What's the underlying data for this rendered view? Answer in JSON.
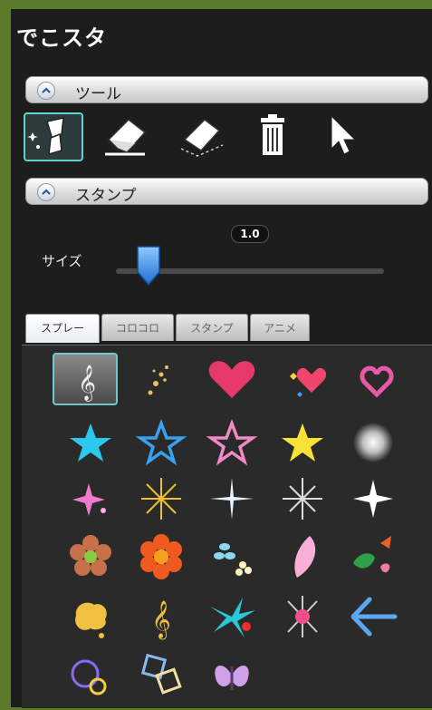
{
  "app": {
    "title": "でこスタ"
  },
  "sections": {
    "tools": {
      "label": "ツール",
      "icons": [
        "magic-brush-icon",
        "eraser-icon",
        "eraser-outline-icon",
        "trash-icon",
        "pointer-icon"
      ],
      "selected_index": 0
    },
    "stamp": {
      "label": "スタンプ"
    }
  },
  "size": {
    "label": "サイズ",
    "value": "1.0",
    "level": 0.1
  },
  "tabs": {
    "items": [
      "スプレー",
      "コロコロ",
      "スタンプ",
      "アニメ"
    ],
    "active_index": 0
  },
  "stamps": {
    "selected_index": 0,
    "icons": [
      "treble-clef-icon",
      "sparkle-trail-icon",
      "pink-heart-icon",
      "hearts-icon",
      "heart-outline-icon",
      "cyan-star-icon",
      "blue-star-outline-icon",
      "pink-star-outline-icon",
      "yellow-star-icon",
      "white-glow-icon",
      "pink-sparkle-icon",
      "gold-sparkle-icon",
      "white-twinkle-icon",
      "silver-twinkle-icon",
      "white-four-point-star-icon",
      "brown-flower-icon",
      "orange-flower-icon",
      "blue-flowers-icon",
      "pink-petal-icon",
      "leaves-icon",
      "yellow-splash-icon",
      "gold-clef-icon",
      "cyan-shuriken-icon",
      "dark-burst-icon",
      "blue-arrow-icon",
      "circles-icon",
      "squares-icon",
      "butterfly-icon"
    ]
  },
  "colors": {
    "panel": "#1d1d1d",
    "accent": "#5fd2d2",
    "frame": "#5b7a2a"
  }
}
